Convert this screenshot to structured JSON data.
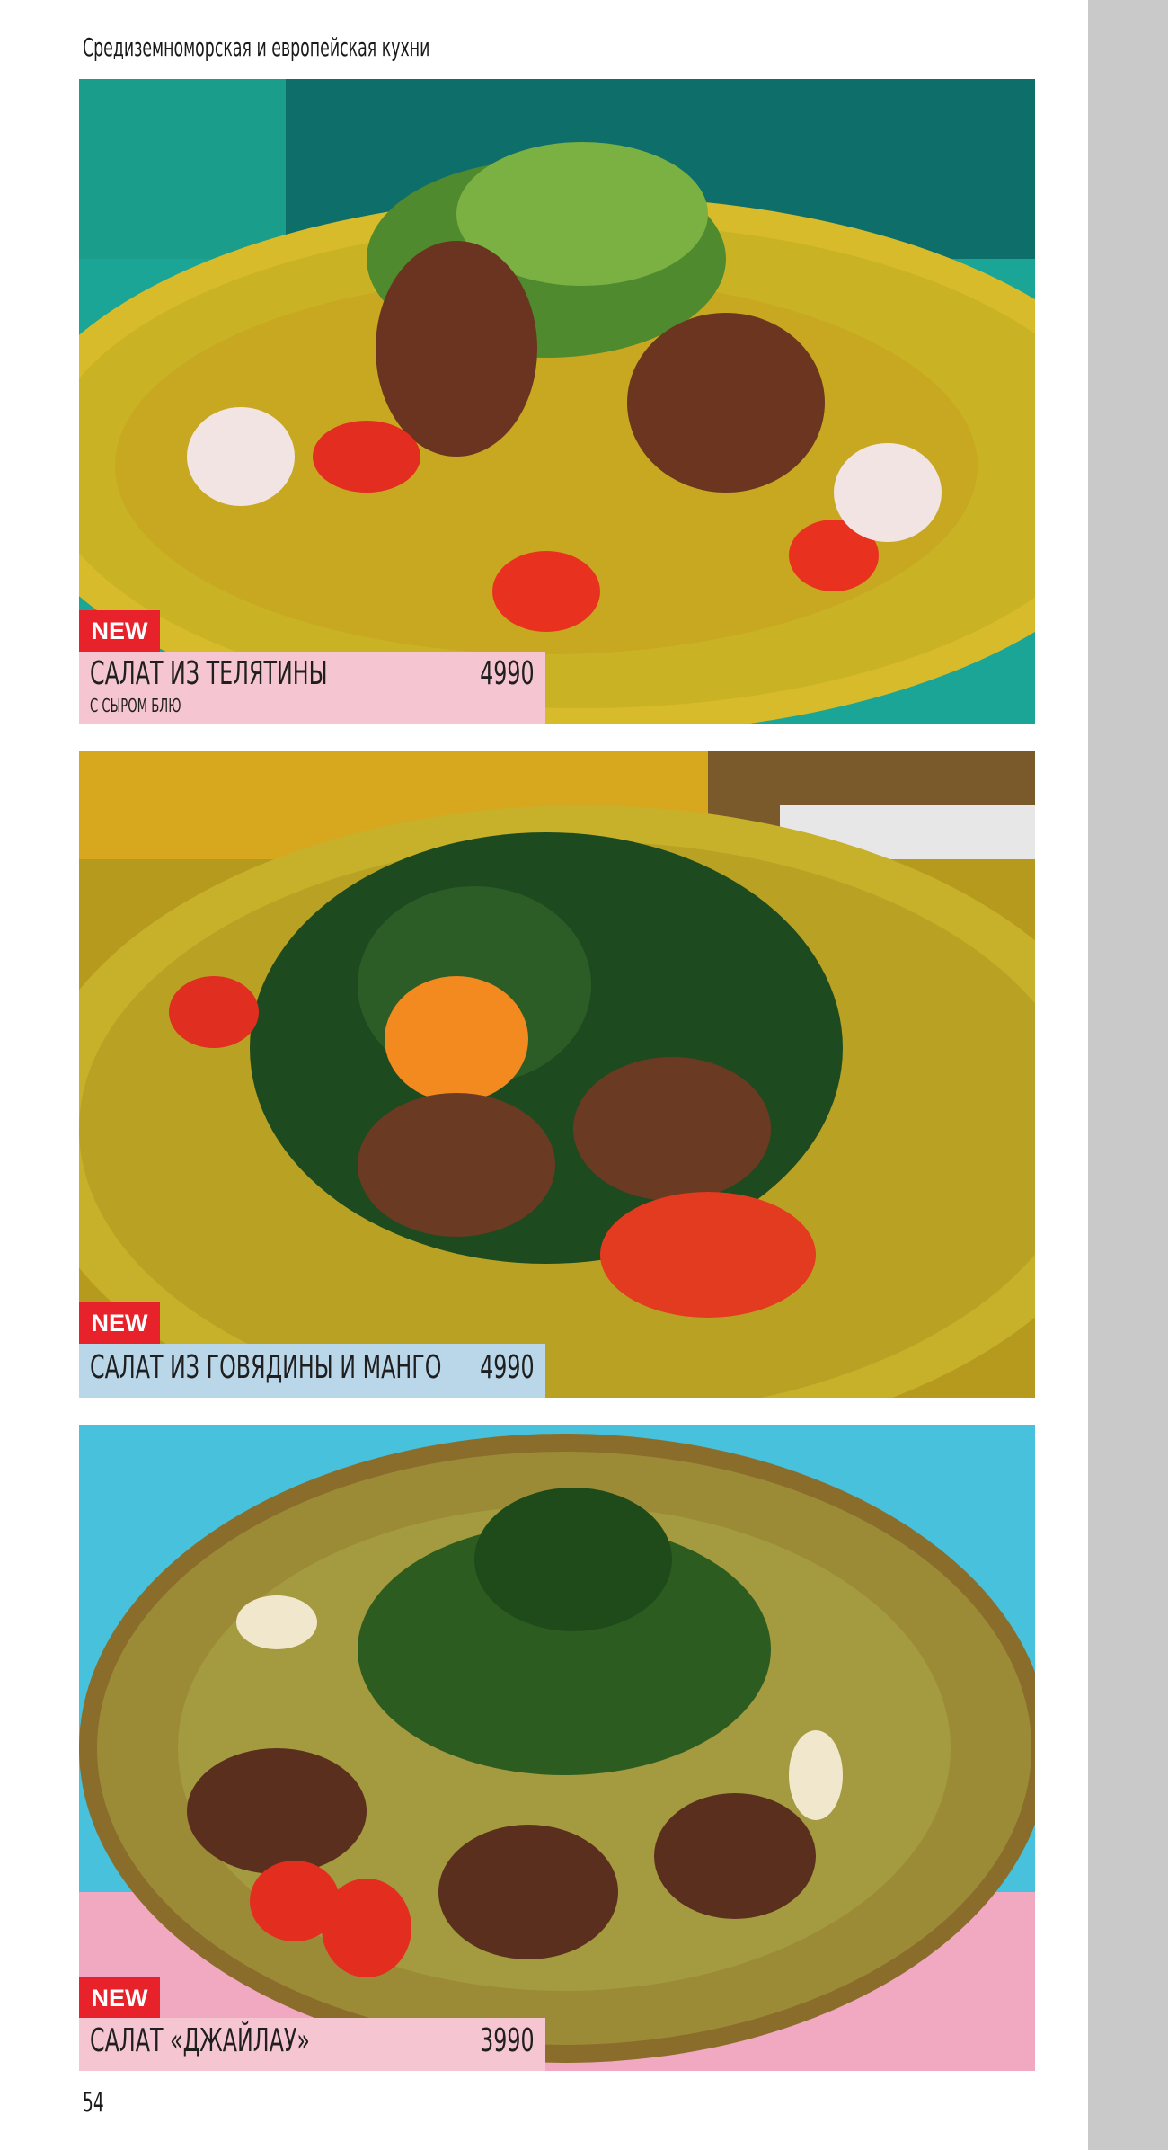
{
  "page": {
    "section_title": "Средиземноморская и европейская кухни",
    "page_number": "54"
  },
  "dishes": [
    {
      "badge": "NEW",
      "name": "САЛАТ ИЗ ТЕЛЯТИНЫ",
      "subtitle": "С СЫРОМ БЛЮ",
      "price": "4990",
      "label_color": "#f5c6d1"
    },
    {
      "badge": "NEW",
      "name": "САЛАТ ИЗ ГОВЯДИНЫ И МАНГО",
      "price": "4990",
      "label_color": "#b9d7e8"
    },
    {
      "badge": "NEW",
      "name": "САЛАТ «ДЖАЙЛАУ»",
      "price": "3990",
      "label_color": "#f5c6d1"
    }
  ],
  "colors": {
    "badge": "#e8222b",
    "sidebar": "#c9c9c9"
  }
}
